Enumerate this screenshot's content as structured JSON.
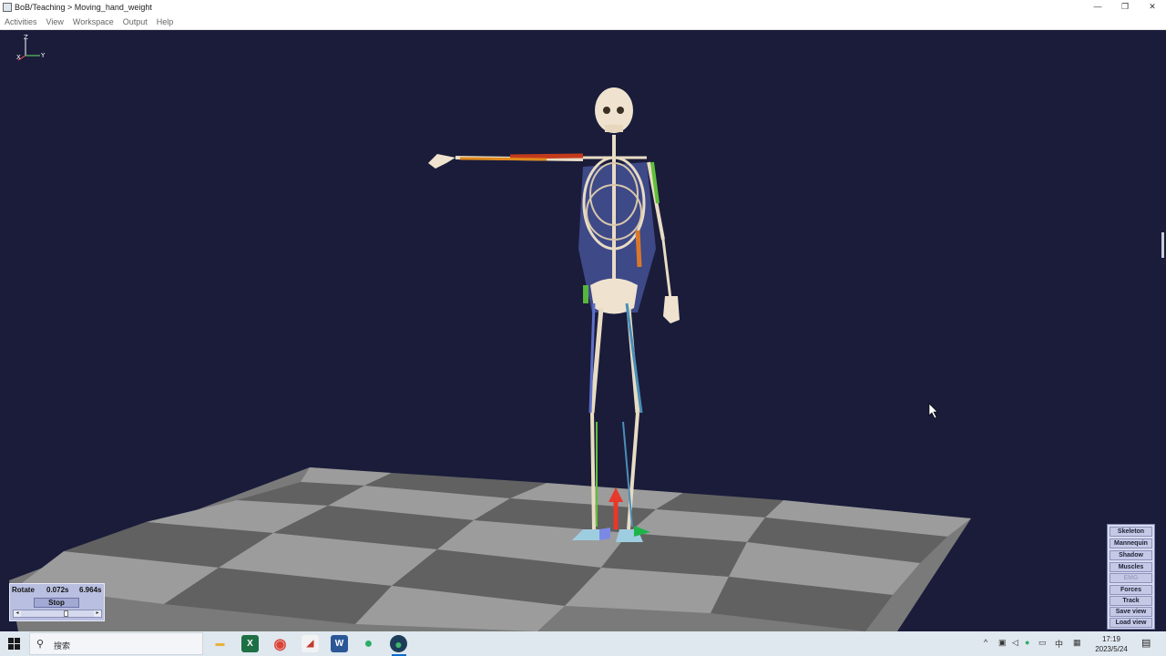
{
  "window": {
    "title": "BoB/Teaching > Moving_hand_weight",
    "minimize_glyph": "—",
    "restore_glyph": "❐",
    "close_glyph": "✕"
  },
  "menu": {
    "items": [
      "Activities",
      "View",
      "Workspace",
      "Output",
      "Help"
    ]
  },
  "viewport": {
    "background": "#1a1c3a",
    "axis_labels": {
      "z": "Z",
      "x": "X",
      "y": "Y"
    }
  },
  "playback": {
    "mode_label": "Rotate",
    "current_time": "0.072s",
    "total_time": "6.964s",
    "stop_label": "Stop",
    "left_arrow": "◂",
    "right_arrow": "▸",
    "position_fraction": 0.62
  },
  "side_panel": {
    "buttons": [
      {
        "label": "Skeleton",
        "enabled": true
      },
      {
        "label": "Mannequin",
        "enabled": true
      },
      {
        "label": "Shadow",
        "enabled": true
      },
      {
        "label": "Muscles",
        "enabled": true
      },
      {
        "label": "EMG",
        "enabled": false
      },
      {
        "label": "Forces",
        "enabled": true
      },
      {
        "label": "Track",
        "enabled": true
      },
      {
        "label": "Save view",
        "enabled": true
      },
      {
        "label": "Load view",
        "enabled": true
      }
    ]
  },
  "taskbar": {
    "search_placeholder": "搜索",
    "apps": [
      {
        "name": "file-explorer",
        "glyph": "▬",
        "color": "#e8b33a"
      },
      {
        "name": "excel",
        "glyph": "X",
        "color": "#1d7044"
      },
      {
        "name": "chrome",
        "glyph": "◉",
        "color": "#db4437"
      },
      {
        "name": "acrobat",
        "glyph": "◢",
        "color": "#d0d0d0"
      },
      {
        "name": "word",
        "glyph": "W",
        "color": "#2b5797"
      },
      {
        "name": "wechat",
        "glyph": "●",
        "color": "#2aae67"
      },
      {
        "name": "bob-app",
        "glyph": "●",
        "color": "#1c3d5a"
      }
    ],
    "tray": {
      "chevron": "^",
      "ime": "中",
      "clock_time": "17:19",
      "clock_date": "2023/5/24"
    }
  }
}
